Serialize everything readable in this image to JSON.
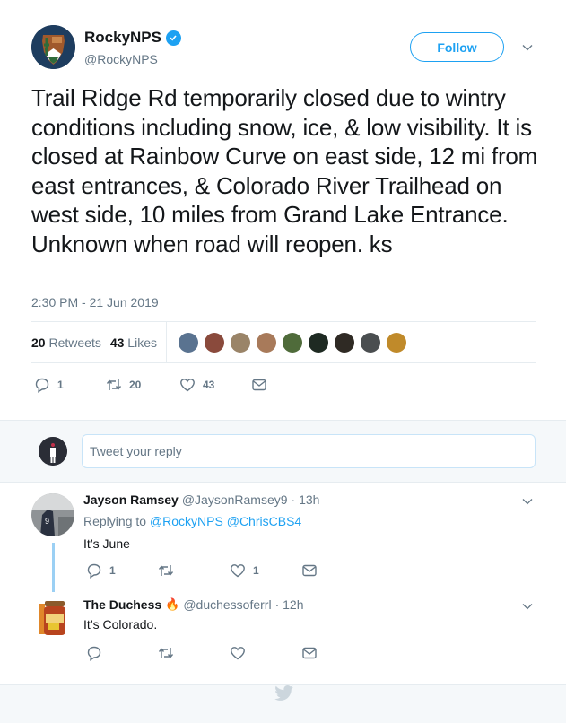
{
  "tweet": {
    "author": {
      "name": "RockyNPS",
      "handle": "@RockyNPS",
      "verified": true,
      "avatar_icon": "nps-arrowhead-logo"
    },
    "follow_label": "Follow",
    "text": "Trail Ridge Rd temporarily closed due to wintry conditions including snow, ice, & low visibility. It is closed at Rainbow Curve on east side, 12 mi from east entrances, & Colorado River Trailhead on west side, 10 miles from Grand Lake Entrance. Unknown when road will reopen. ks",
    "timestamp": "2:30 PM - 21 Jun 2019",
    "stats": {
      "retweets_count": "20",
      "retweets_label": "Retweets",
      "likes_count": "43",
      "likes_label": "Likes"
    },
    "liker_avatar_colors": [
      "#5a7390",
      "#8a4a3c",
      "#9a8468",
      "#a87a5a",
      "#4f6b3a",
      "#1e2a22",
      "#2f2a24",
      "#4a4e50",
      "#c08a2a"
    ],
    "actions": {
      "reply_count": "1",
      "retweet_count": "20",
      "like_count": "43"
    }
  },
  "reply_composer": {
    "placeholder": "Tweet your reply"
  },
  "replies": [
    {
      "name": "Jayson Ramsey",
      "handle": "@JaysonRamsey9",
      "time": "· 13h",
      "replying_to_label": "Replying to",
      "replying_to": [
        "@RockyNPS",
        "@ChrisCBS4"
      ],
      "text": "It’s June",
      "reply_count": "1",
      "retweet_count": "",
      "like_count": "1"
    },
    {
      "name": "The Duchess",
      "name_emoji": "🔥",
      "handle": "@duchessoferrl",
      "time": "· 12h",
      "text": "It’s Colorado.",
      "reply_count": "",
      "retweet_count": "",
      "like_count": ""
    }
  ],
  "colors": {
    "accent": "#1da1f2",
    "text": "#14171a",
    "secondary_text": "#657786",
    "border": "#e6ecf0",
    "background_alt": "#f5f8fa",
    "thread_line": "#9bd0f4"
  }
}
